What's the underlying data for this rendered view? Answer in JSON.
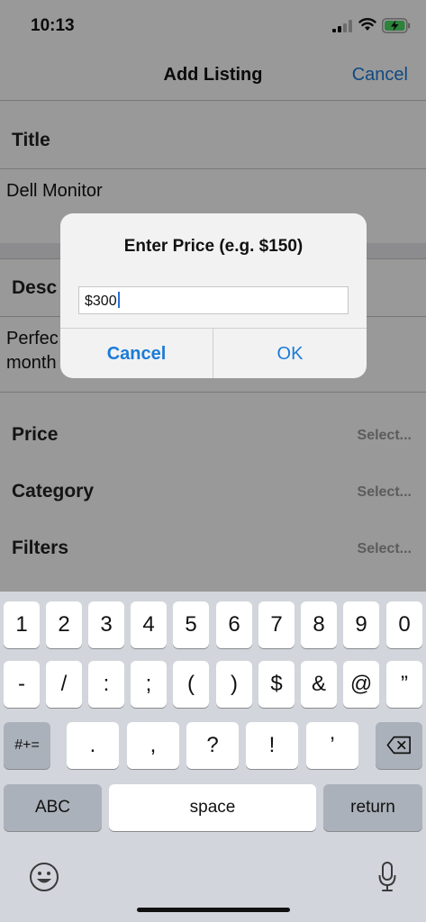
{
  "status_bar": {
    "time": "10:13"
  },
  "nav": {
    "title": "Add Listing",
    "cancel_label": "Cancel"
  },
  "form": {
    "title_label": "Title",
    "title_value": "Dell Monitor",
    "description_label": "Desc",
    "description_value_line1": "Perfec",
    "description_value_line2": "month",
    "price_label": "Price",
    "price_select": "Select...",
    "category_label": "Category",
    "category_select": "Select...",
    "filters_label": "Filters",
    "filters_select": "Select..."
  },
  "alert": {
    "title": "Enter Price (e.g. $150)",
    "input_value": "$300",
    "cancel_label": "Cancel",
    "ok_label": "OK"
  },
  "keyboard": {
    "row1": [
      "1",
      "2",
      "3",
      "4",
      "5",
      "6",
      "7",
      "8",
      "9",
      "0"
    ],
    "row2": [
      "-",
      "/",
      ":",
      ";",
      "(",
      ")",
      "$",
      "&",
      "@",
      "”"
    ],
    "row3_mode": "#+=",
    "row3": [
      ".",
      ",",
      "?",
      "!",
      "’"
    ],
    "abc_label": "ABC",
    "space_label": "space",
    "return_label": "return"
  },
  "colors": {
    "accent": "#1b7bd8",
    "keyboard_bg": "#d2d5db",
    "select_gray": "#9a9a9a"
  }
}
